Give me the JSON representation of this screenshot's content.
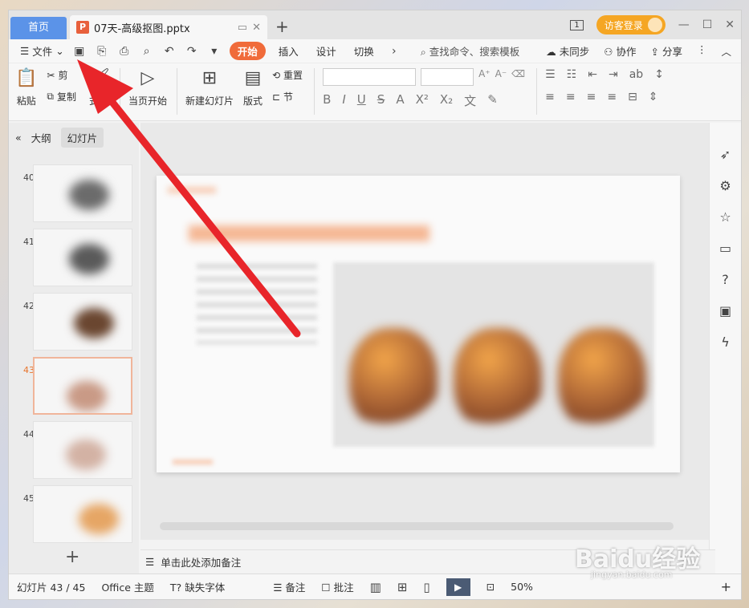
{
  "titlebar": {
    "home_tab": "首页",
    "doc_name": "07天-高级抠图.pptx",
    "doc_icon": "P",
    "window_number": "1",
    "login_label": "访客登录"
  },
  "menubar": {
    "file_label": "文件",
    "tabs": [
      "开始",
      "插入",
      "设计",
      "切换"
    ],
    "search_placeholder": "查找命令、搜索模板",
    "sync_label": "未同步",
    "collab_label": "协作",
    "share_label": "分享"
  },
  "ribbon": {
    "paste": "粘贴",
    "cut": "剪",
    "copy": "复制",
    "format_painter": "式刷",
    "play_current": "当页开始",
    "new_slide": "新建幻灯片",
    "layout": "版式",
    "reset": "重置",
    "section": "节"
  },
  "leftpanel": {
    "outline_tab": "大纲",
    "slides_tab": "幻灯片",
    "slide_numbers": [
      "40",
      "41",
      "42",
      "43",
      "44",
      "45"
    ],
    "active_slide": "43"
  },
  "notes": {
    "placeholder": "单击此处添加备注"
  },
  "statusbar": {
    "slide_info": "幻灯片 43 / 45",
    "theme": "Office 主题",
    "missing_font": "缺失字体",
    "notes_label": "备注",
    "comment_label": "批注",
    "zoom": "50%"
  },
  "watermark": {
    "text": "Baidu经验",
    "sub": "jingyan.baidu.com"
  },
  "colors": {
    "accent": "#f06b3a",
    "home_tab": "#5b93e8",
    "login": "#f5a623",
    "arrow": "#e8252a"
  }
}
